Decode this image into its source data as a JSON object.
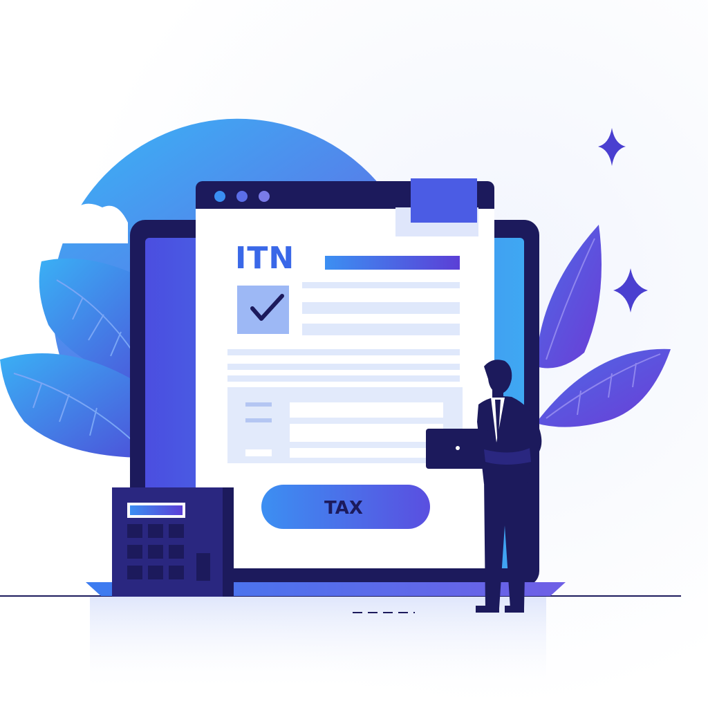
{
  "document": {
    "title": "ITN",
    "checkbox_checked": true
  },
  "button": {
    "label": "TAX"
  },
  "icons": {
    "checkmark": "check-icon",
    "sparkles": "sparkle-icon",
    "person": "businessman-figure",
    "calculator": "calculator-icon",
    "laptop": "laptop-icon"
  },
  "colors": {
    "accent_blue": "#3a7bf0",
    "accent_purple": "#5b3fd6",
    "navy": "#1c1a5c",
    "pale_blue": "#dfe8fb",
    "background": "#ffffff"
  }
}
